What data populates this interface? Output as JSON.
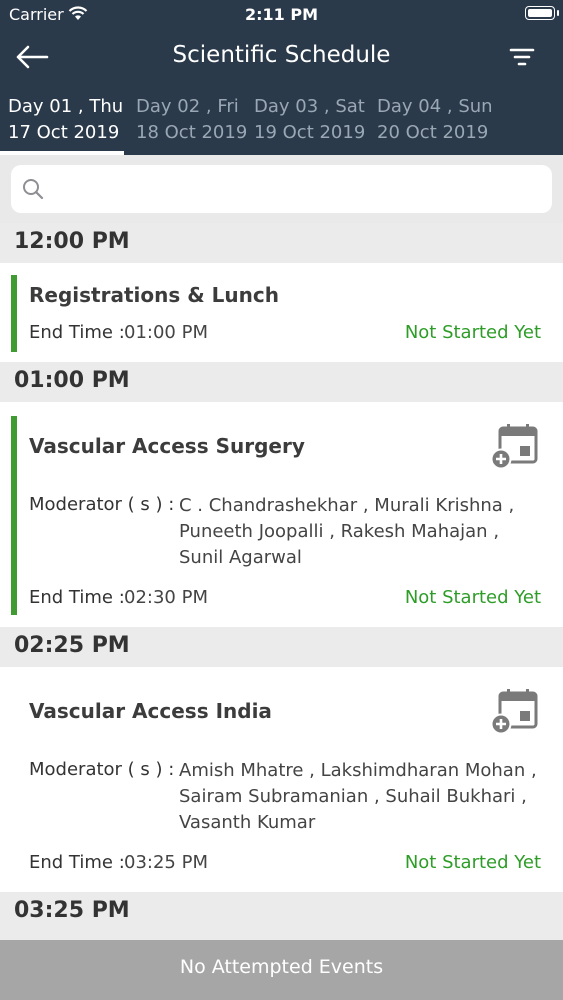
{
  "status_bar": {
    "carrier": "Carrier",
    "time": "2:11 PM"
  },
  "nav": {
    "title": "Scientific Schedule"
  },
  "tabs": [
    {
      "line1": "Day 01 , Thu",
      "line2": "17 Oct 2019",
      "active": true
    },
    {
      "line1": "Day 02 , Fri",
      "line2": "18 Oct 2019",
      "active": false
    },
    {
      "line1": "Day 03 , Sat",
      "line2": "19 Oct 2019",
      "active": false
    },
    {
      "line1": "Day 04 , Sun",
      "line2": "20 Oct 2019",
      "active": false
    }
  ],
  "search": {
    "placeholder": ""
  },
  "sessions": [
    {
      "time": "12:00 PM",
      "title": "Registrations & Lunch",
      "end_label": "End Time :",
      "end_time": "01:00 PM",
      "status": "Not Started Yet"
    },
    {
      "time": "01:00 PM",
      "title": "Vascular Access Surgery",
      "moderator_label": "Moderator ( s ) :",
      "moderators": [
        "C . Chandrashekhar , Murali Krishna ,",
        "Puneeth Joopalli , Rakesh Mahajan ,",
        "Sunil Agarwal"
      ],
      "end_label": "End Time :",
      "end_time": "02:30 PM",
      "status": "Not Started Yet"
    },
    {
      "time": "02:25 PM",
      "title": "Vascular Access India",
      "moderator_label": "Moderator ( s ) :",
      "moderators": [
        "Amish Mhatre , Lakshimdharan Mohan ,",
        "Sairam Subramanian , Suhail Bukhari ,",
        "Vasanth Kumar"
      ],
      "end_label": "End Time :",
      "end_time": "03:25 PM",
      "status": "Not Started Yet"
    },
    {
      "time": "03:25 PM"
    }
  ],
  "footer": {
    "text": "No Attempted Events"
  },
  "colors": {
    "header": "#2b3a4a",
    "status_green": "#2e9d28",
    "session_bar": "#3f9b32",
    "footer": "#a6a6a6"
  },
  "icons": [
    "back-arrow-icon",
    "filter-icon",
    "search-icon",
    "calendar-add-icon",
    "wifi-icon",
    "battery-icon"
  ]
}
